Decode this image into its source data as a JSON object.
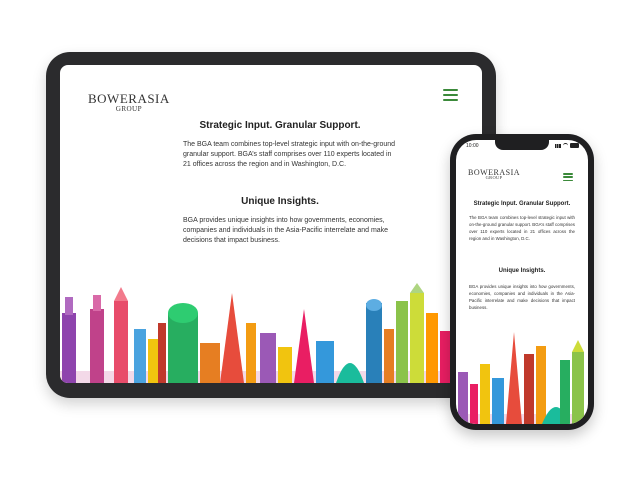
{
  "brand": {
    "name_top": "BOWERASIA",
    "name_sub": "GROUP",
    "accent_color": "#3b8a3a"
  },
  "tablet": {
    "section1_title": "Strategic Input. Granular Support.",
    "section1_body": "The BGA team combines top-level strategic input with on-the-ground granular support. BGA’s staff comprises over 110 experts located in 21 offices across the region and in Washington, D.C.",
    "section2_title": "Unique Insights.",
    "section2_body": "BGA provides unique insights into how governments, economies, companies and individuals in the Asia-Pacific interrelate and make decisions that impact business."
  },
  "phone": {
    "time": "10:00",
    "section1_title": "Strategic Input. Granular Support.",
    "section1_body": "The BGA team combines top-level strategic input with on-the-ground granular support. BGA’s staff comprises over 110 experts located in 21 offices across the region and in Washington, D.C.",
    "section2_title": "Unique Insights.",
    "section2_body": "BGA provides unique insights into how governments, economies, companies and individuals in the Asia-Pacific interrelate and make decisions that impact business."
  },
  "icons": {
    "menu": "hamburger-menu-icon",
    "signal": "signal-icon",
    "wifi": "wifi-icon",
    "battery": "battery-icon"
  }
}
